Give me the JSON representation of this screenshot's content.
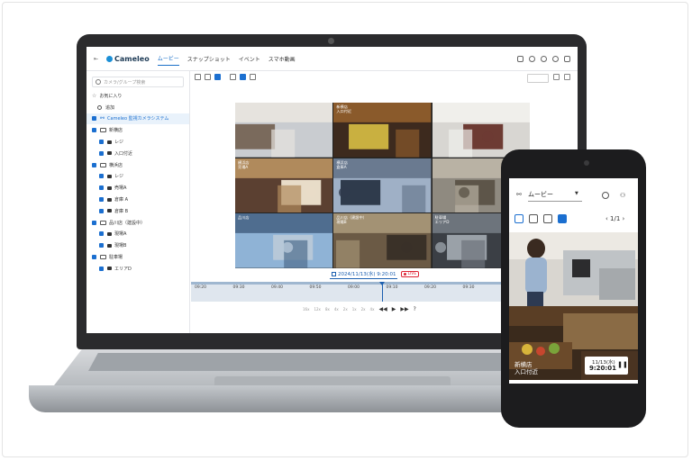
{
  "app": {
    "logo_text": "Cameleo",
    "tabs": [
      {
        "label": "ムービー",
        "active": true
      },
      {
        "label": "スナップショット",
        "active": false
      },
      {
        "label": "イベント",
        "active": false
      },
      {
        "label": "スマホ動画",
        "active": false
      }
    ]
  },
  "sidebar": {
    "search_placeholder": "カメラ/グループ検索",
    "favorites_label": "お気に入り",
    "add_label": "追加",
    "system_label": "Cameleo 監視カメラシステム",
    "tree": [
      {
        "type": "group",
        "label": "新横店"
      },
      {
        "type": "camera",
        "label": "レジ"
      },
      {
        "type": "camera",
        "label": "入口付近"
      },
      {
        "type": "group",
        "label": "横浜店"
      },
      {
        "type": "camera",
        "label": "レジ"
      },
      {
        "type": "camera",
        "label": "売場A"
      },
      {
        "type": "camera",
        "label": "倉庫 A"
      },
      {
        "type": "camera",
        "label": "倉庫 B"
      },
      {
        "type": "group",
        "label": "品川店（建設中）"
      },
      {
        "type": "camera",
        "label": "現場A"
      },
      {
        "type": "camera",
        "label": "現場B"
      },
      {
        "type": "group",
        "label": "駐車場"
      },
      {
        "type": "camera",
        "label": "エリアD"
      }
    ]
  },
  "grid": {
    "cells": [
      {
        "label": "",
        "palette": [
          "#c9ccd0",
          "#e6e3de",
          "#7a6a5c"
        ]
      },
      {
        "label": "新横店\n入口付近",
        "palette": [
          "#3d2a1e",
          "#8a5a2b",
          "#c9b040"
        ]
      },
      {
        "label": "",
        "palette": [
          "#d8d6d2",
          "#f0efeb",
          "#6d3b33"
        ]
      },
      {
        "label": "横浜店\n売場A",
        "palette": [
          "#5b4031",
          "#b08a5c",
          "#e8dcc8"
        ]
      },
      {
        "label": "横浜店\n倉庫A",
        "palette": [
          "#9fb0c6",
          "#6a7a90",
          "#2f3b4c"
        ]
      },
      {
        "label": "",
        "palette": [
          "#8f8a80",
          "#b9b2a4",
          "#5d5549"
        ]
      },
      {
        "label": "品川店",
        "palette": [
          "#8fb3d6",
          "#4f6d8f",
          "#b7c8d8"
        ]
      },
      {
        "label": "品川店（建設中）\n現場B",
        "palette": [
          "#6b5a45",
          "#a39274",
          "#3a3128"
        ]
      },
      {
        "label": "駐車場\nエリアD",
        "palette": [
          "#3b3f45",
          "#6d747c",
          "#9aa1a8"
        ]
      }
    ]
  },
  "timeline": {
    "datetime": "2024/11/13(水) 9:20:01",
    "live_label": "LIVE",
    "ticks": [
      "09:20",
      "09:30",
      "09:40",
      "09:50",
      "09:00",
      "09:10",
      "09:20",
      "09:30",
      "09:40",
      "09:50"
    ],
    "speeds": [
      "16x",
      "12x",
      "8x",
      "4x",
      "2x",
      "1x",
      "2x",
      "4x"
    ]
  },
  "phone": {
    "title": "ムービー",
    "pager": "1/1",
    "overlay_label_line1": "新横店",
    "overlay_label_line2": "入口付近",
    "date": "11/13(水)",
    "time": "9:20:01"
  }
}
